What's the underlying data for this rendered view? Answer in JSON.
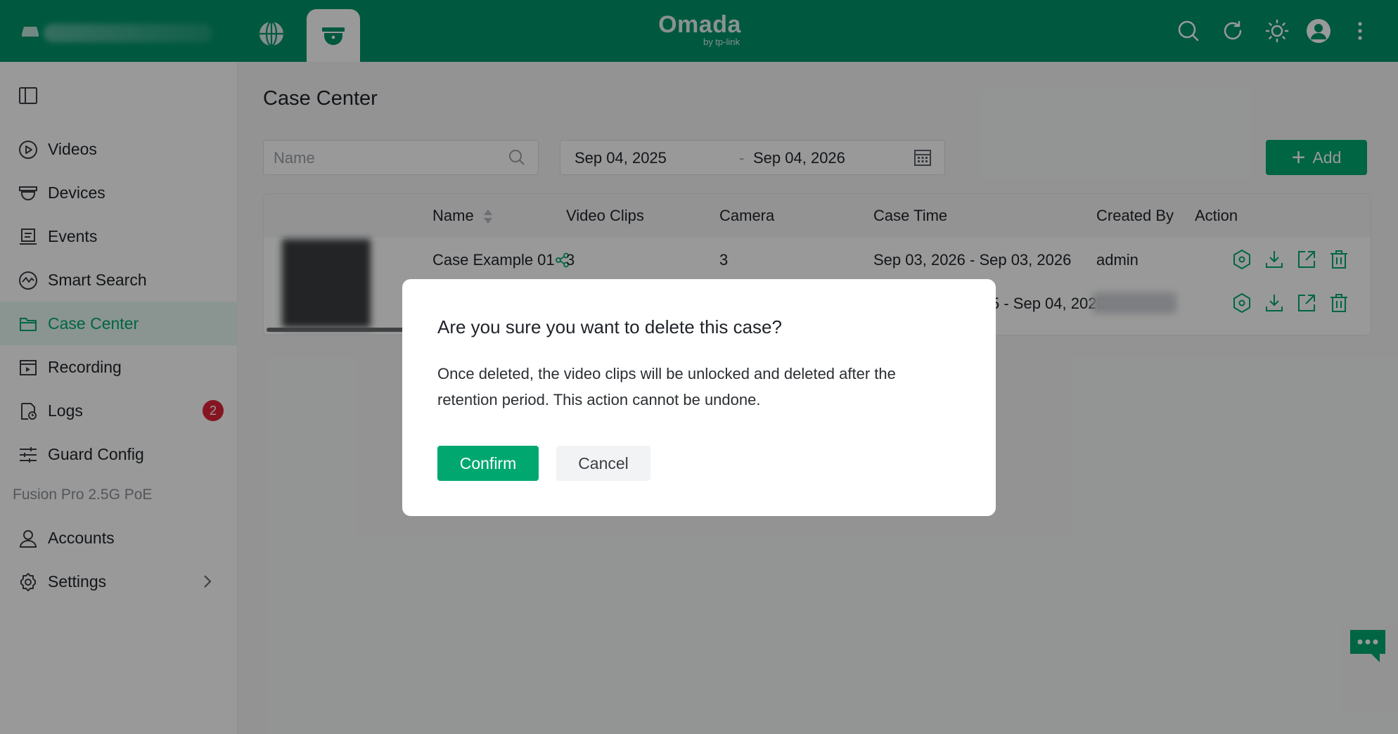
{
  "header": {
    "logo_main": "Omada",
    "logo_sub": "by tp-link",
    "icons": [
      "site-icon",
      "globe-icon",
      "camera-icon",
      "search-icon",
      "refresh-icon",
      "theme-icon",
      "user-avatar-icon",
      "more-icon"
    ]
  },
  "sidebar": {
    "items": [
      {
        "label": "Videos",
        "icon": "play-icon"
      },
      {
        "label": "Devices",
        "icon": "camera-dome-icon"
      },
      {
        "label": "Events",
        "icon": "events-icon"
      },
      {
        "label": "Smart Search",
        "icon": "smart-search-icon"
      },
      {
        "label": "Case Center",
        "icon": "folder-icon",
        "active": true
      },
      {
        "label": "Recording",
        "icon": "recording-icon"
      },
      {
        "label": "Logs",
        "icon": "logs-icon",
        "badge": "2"
      },
      {
        "label": "Guard Config",
        "icon": "sliders-icon"
      }
    ],
    "section_label": "Fusion Pro 2.5G PoE",
    "bottom_items": [
      {
        "label": "Accounts",
        "icon": "user-icon"
      },
      {
        "label": "Settings",
        "icon": "gear-icon"
      }
    ]
  },
  "main": {
    "title": "Case Center",
    "search_placeholder": "Name",
    "date_start": "Sep 04, 2025",
    "date_separator": "-",
    "date_end": "Sep 04, 2026",
    "add_label": "Add",
    "table": {
      "columns": [
        "Name",
        "Video Clips",
        "Camera",
        "Case Time",
        "Created By",
        "Action"
      ],
      "rows": [
        {
          "name": "Case Example 01",
          "video_clips": "3",
          "camera": "3",
          "case_time": "Sep 03, 2026 - Sep 03, 2026",
          "created_by": "admin"
        },
        {
          "name": "",
          "video_clips": "",
          "camera": "",
          "case_time": "5 - Sep 04, 2026",
          "created_by": ""
        }
      ]
    }
  },
  "modal": {
    "title": "Are you sure you want to delete this case?",
    "body": "Once deleted, the video clips will be unlocked and deleted after the retention period. This action cannot be undone.",
    "confirm_label": "Confirm",
    "cancel_label": "Cancel"
  },
  "colors": {
    "brand": "#00936a",
    "accent": "#00a870",
    "badge": "#e0243a"
  }
}
